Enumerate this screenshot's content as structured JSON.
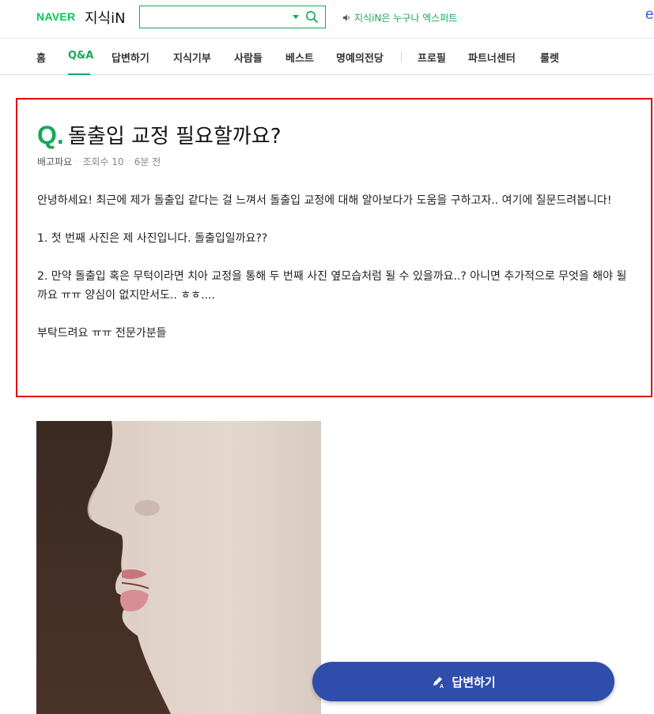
{
  "header": {
    "brand": "NAVER",
    "service": "지식iN",
    "search": {
      "value": "",
      "placeholder": ""
    },
    "notice": "지식iN은 누구나 엑스퍼트",
    "right_edge_text": "e",
    "accent_color": "#17a85a"
  },
  "nav": {
    "items": [
      {
        "label": "홈"
      },
      {
        "label": "Q&A"
      },
      {
        "label": "답변하기"
      },
      {
        "label": "지식기부"
      },
      {
        "label": "사람들"
      },
      {
        "label": "베스트"
      },
      {
        "label": "명예의전당"
      },
      {
        "label": "프로필"
      },
      {
        "label": "파트너센터"
      },
      {
        "label": "룰렛"
      }
    ],
    "active": "Q&A"
  },
  "question": {
    "mark": "Q.",
    "title": "돌출입 교정 필요할까요?",
    "author": "배고파요",
    "views": "조회수 10",
    "time": "6분 전",
    "paragraphs": [
      "안녕하세요! 최근에 제가 돌출입 같다는 걸 느껴서 돌출입 교정에 대해 알아보다가 도움을 구하고자.. 여기에 질문드려봅니다!",
      "1. 첫 번째 사진은 제 사진입니다. 돌출입일까요??",
      "2. 만약 돌출입 혹은 무턱이라면 치아 교정을 통해 두 번째 사진 옆모습처럼 될 수 있을까요..? 아니면 추가적으로 무엇을 해야 될까요 ㅠㅠ 양심이 없지만서도.. ㅎㅎ....",
      "부탁드려요 ㅠㅠ 전문가분들"
    ],
    "highlight_color": "#e00000"
  },
  "answer_button": {
    "label": "답변하기",
    "color": "#2f4dab"
  }
}
